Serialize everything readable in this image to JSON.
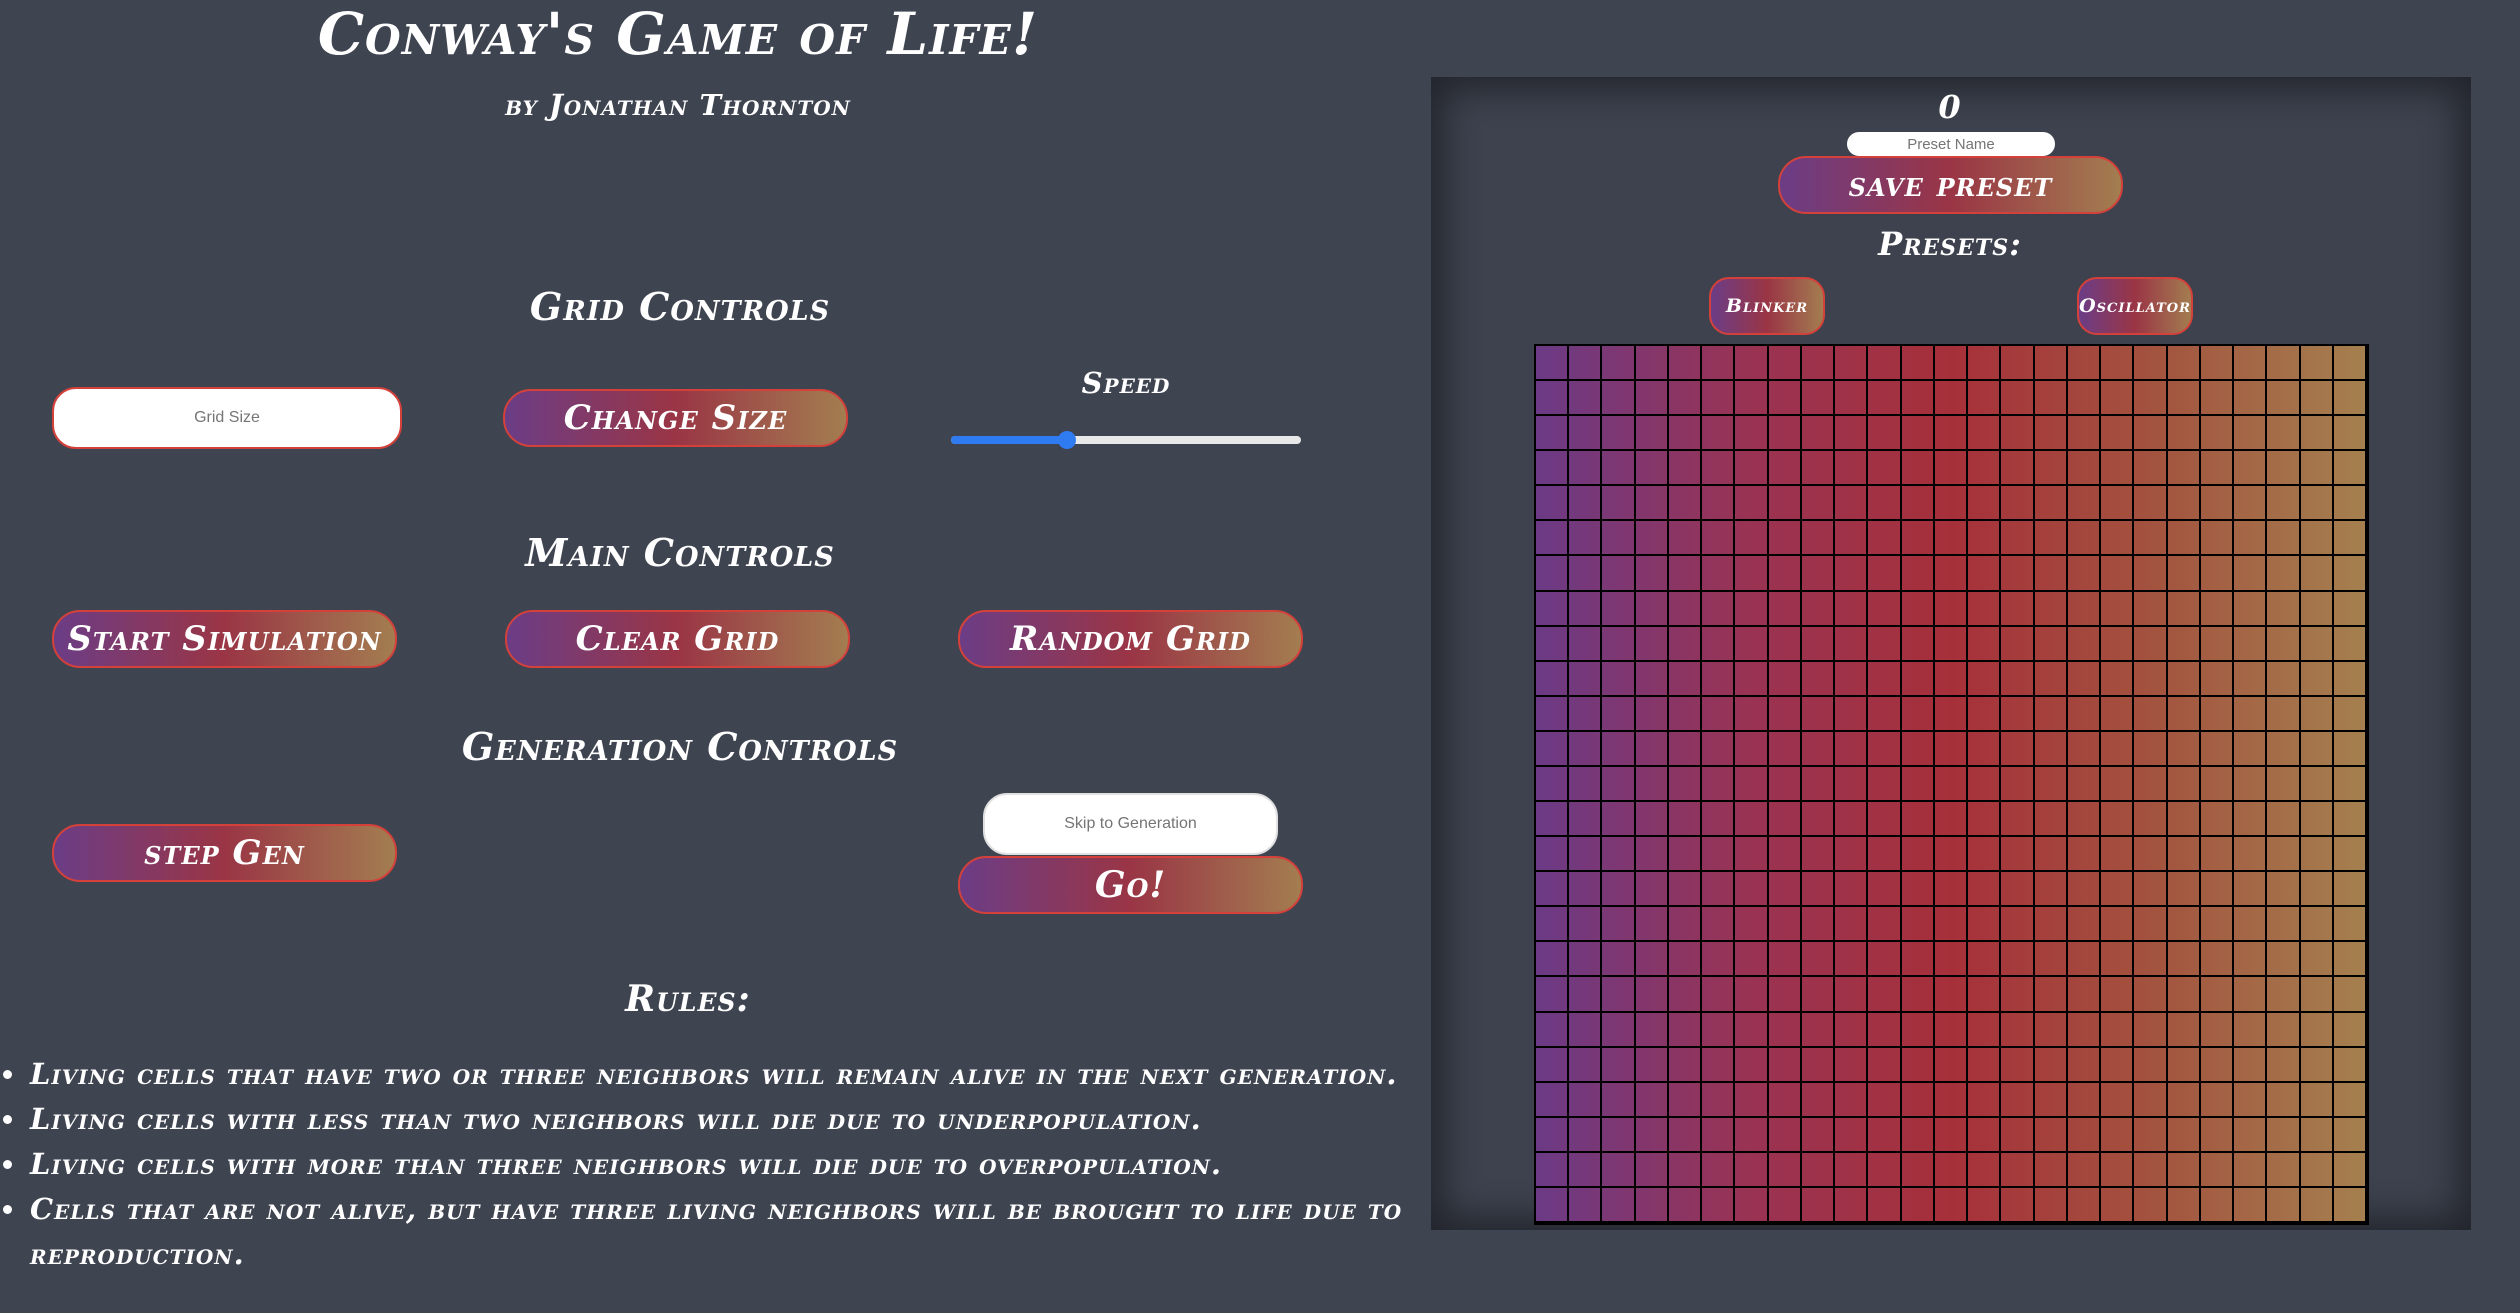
{
  "header": {
    "title": "Conway's Game of Life!",
    "byline": "by Jonathan Thornton"
  },
  "grid_controls": {
    "heading": "Grid Controls",
    "grid_size_placeholder": "Grid Size",
    "change_size_label": "Change Size",
    "speed_label": "Speed",
    "speed_value_fraction": 0.33
  },
  "main_controls": {
    "heading": "Main Controls",
    "start_label": "Start Simulation",
    "clear_label": "Clear Grid",
    "random_label": "Random Grid"
  },
  "generation_controls": {
    "heading": "Generation Controls",
    "step_label": "step Gen",
    "skip_placeholder": "Skip to Generation",
    "go_label": "Go!"
  },
  "rules": {
    "heading": "Rules:",
    "items": [
      "Living cells that have two or three neighbors will remain alive in the next generation.",
      "Living cells with less than two neighbors will die due to underpopulation.",
      "Living cells with more than three neighbors will die due to overpopulation.",
      "Cells that are not alive, but have three living neighbors will be brought to life due to reproduction."
    ]
  },
  "board": {
    "generation": "0",
    "preset_name_placeholder": "Preset Name",
    "save_preset_label": "save preset",
    "presets_heading": "Presets:",
    "presets": [
      "Blinker",
      "Oscillator"
    ],
    "rows": 25,
    "cols": 25
  },
  "colors": {
    "background": "#3f4451",
    "button_border": "#d4413b",
    "gradient_start": "#6b3d86",
    "gradient_mid": "#9a3545",
    "gradient_end": "#a37d50",
    "slider_accent": "#2f7bf2"
  }
}
